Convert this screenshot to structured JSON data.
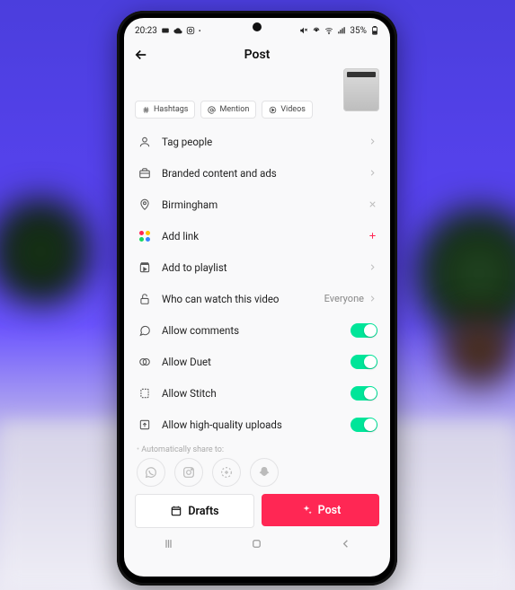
{
  "status": {
    "time": "20:23",
    "battery": "35%"
  },
  "header": {
    "title": "Post"
  },
  "chips": {
    "hashtags": "Hashtags",
    "mention": "Mention",
    "videos": "Videos"
  },
  "rows": {
    "tag_people": "Tag people",
    "branded": "Branded content and ads",
    "location": "Birmingham",
    "add_link": "Add link",
    "playlist": "Add to playlist",
    "privacy": "Who can watch this video",
    "privacy_val": "Everyone",
    "comments": "Allow comments",
    "duet": "Allow Duet",
    "stitch": "Allow Stitch",
    "hq": "Allow high-quality uploads"
  },
  "share_label": "Automatically share to:",
  "buttons": {
    "drafts": "Drafts",
    "post": "Post"
  }
}
